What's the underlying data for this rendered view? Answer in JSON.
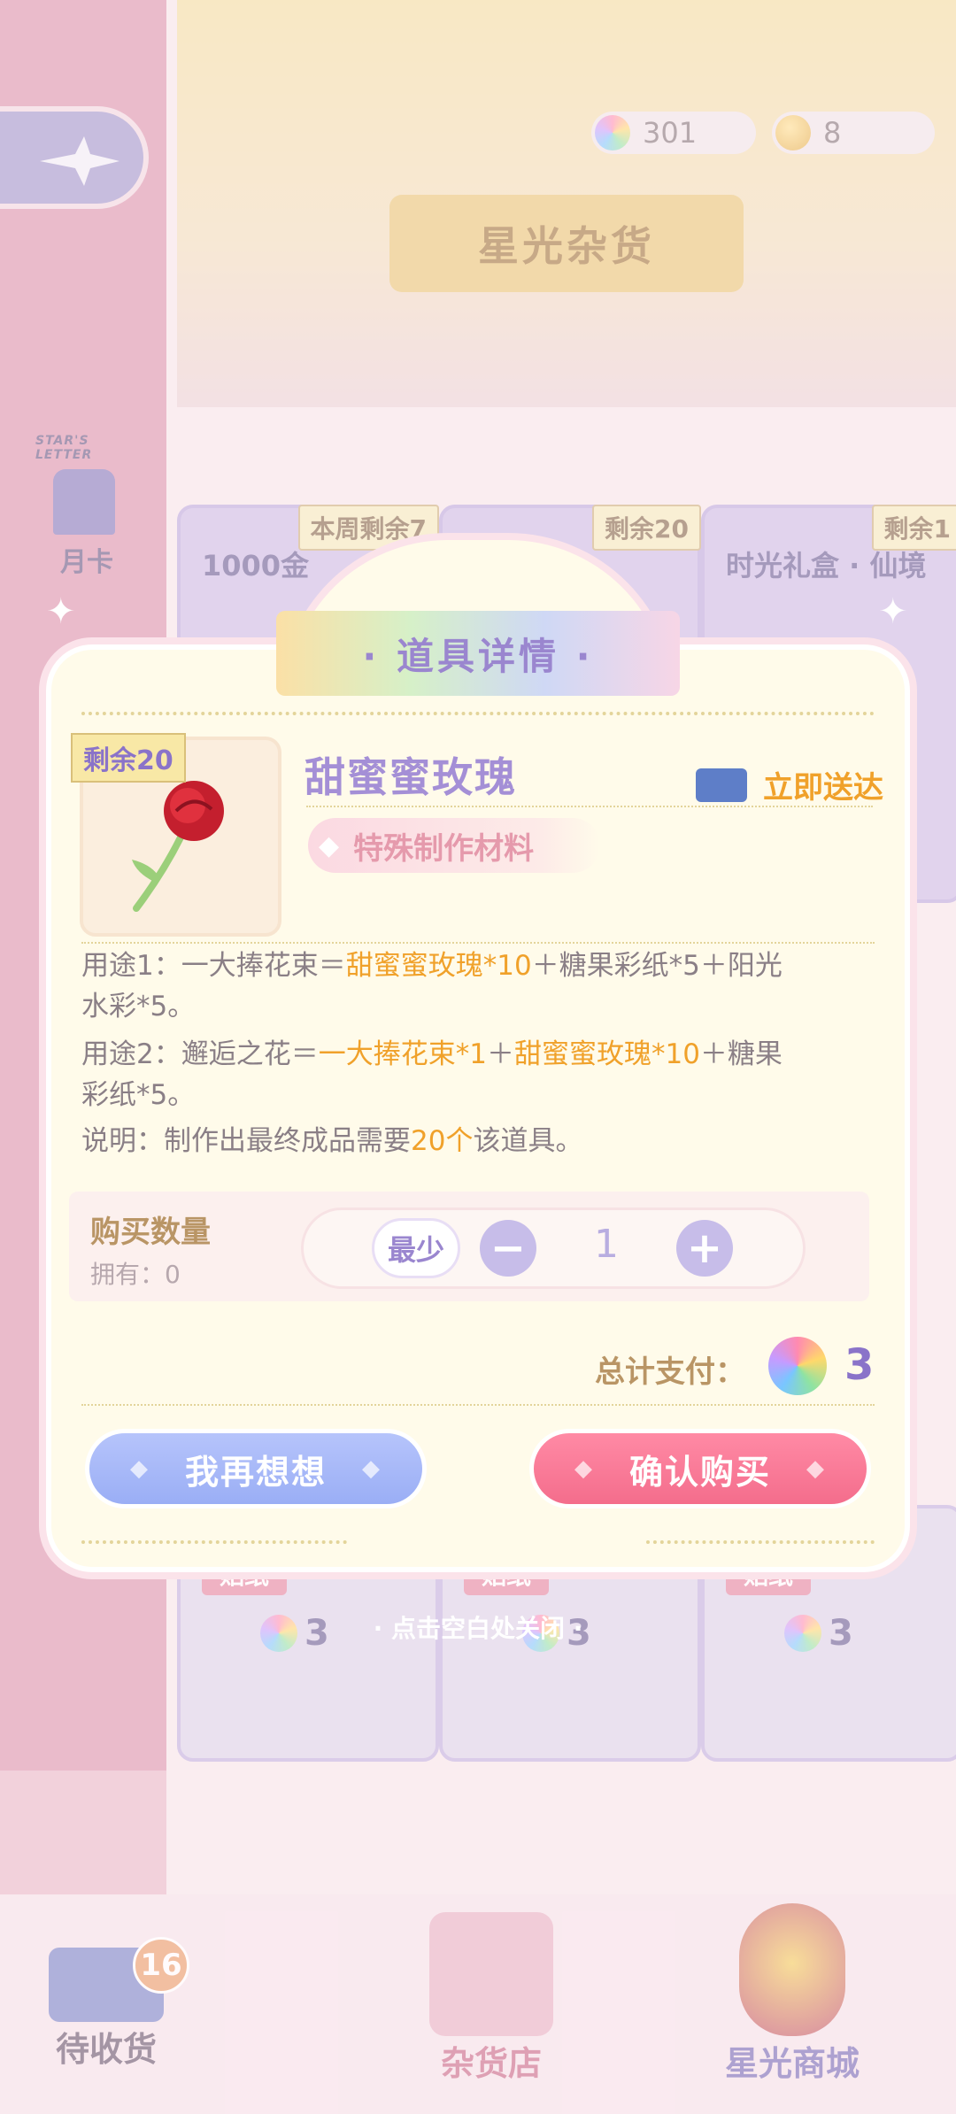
{
  "header": {
    "shop_title": "星光杂货",
    "currency_star": "301",
    "currency_coin": "8"
  },
  "sidebar": {
    "monthly_card_small": "STAR'S LETTER",
    "monthly_card_label": "月卡"
  },
  "background_cards": [
    {
      "tag": "本周剩余7",
      "title": "1000金"
    },
    {
      "tag": "剩余20",
      "title": ""
    },
    {
      "tag": "剩余1",
      "title": "时光礼盒 · 仙境"
    }
  ],
  "background_bottom_cards": [
    {
      "sticker": "贴纸",
      "price": "3"
    },
    {
      "sticker": "贴纸",
      "price": "3"
    },
    {
      "sticker": "贴纸",
      "price": "3"
    }
  ],
  "close_hint": "· 点击空白处关闭 ·",
  "bottom_nav": {
    "pending": "待收货",
    "pending_badge": "16",
    "grocery": "杂货店",
    "star_mall": "星光商城"
  },
  "modal": {
    "title": "· 道具详情 ·",
    "remaining": "剩余20",
    "item_name": "甜蜜蜜玫瑰",
    "delivery": "立即送达",
    "item_type": "特殊制作材料",
    "use1_prefix": "用途1：一大捧花束＝",
    "use1_hl": "甜蜜蜜玫瑰*10",
    "use1_suffix": "＋糖果彩纸*5＋阳光水彩*5。",
    "use2_prefix": "用途2：邂逅之花＝",
    "use2_hl1": "一大捧花束*1",
    "use2_mid": "＋",
    "use2_hl2": "甜蜜蜜玫瑰*10",
    "use2_suffix": "＋糖果彩纸*5。",
    "note_prefix": "说明：制作出最终成品需要",
    "note_hl": "20个",
    "note_suffix": "该道具。",
    "qty_label": "购买数量",
    "own_label": "拥有：0",
    "min_label": "最少",
    "qty_value": "1",
    "total_label": "总计支付：",
    "total_value": "3",
    "cancel_label": "我再想想",
    "confirm_label": "确认购买"
  },
  "colors": {
    "accent_orange": "#f0a12a",
    "accent_purple": "#a48fd6",
    "confirm_pink": "#f46d8c",
    "cancel_blue": "#9aaef5"
  }
}
